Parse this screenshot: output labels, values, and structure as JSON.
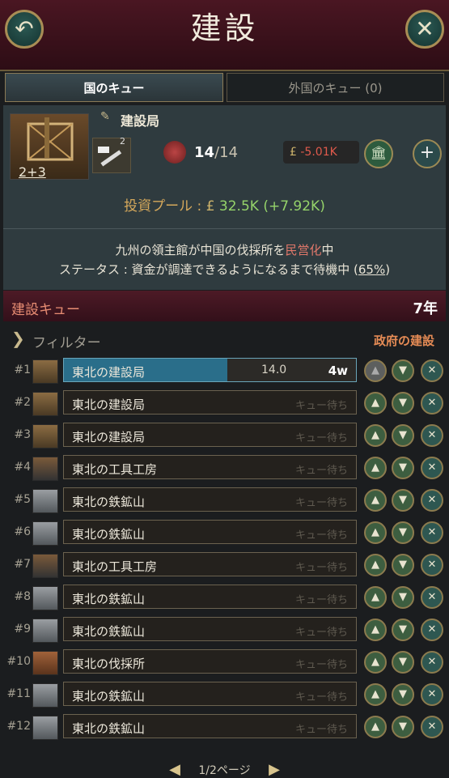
{
  "header": {
    "title": "建設",
    "back_icon": "↶",
    "close_icon": "✕"
  },
  "tabs": {
    "domestic": "国のキュー",
    "foreign": "外国のキュー (0)"
  },
  "building": {
    "name": "建設局",
    "level": "2+3",
    "hammer_count": "2",
    "wood_used": "14",
    "wood_max": "/14",
    "money_sign": "£",
    "money": "-5.01K",
    "add_icon": "+"
  },
  "pool": {
    "label": "投資プール : ",
    "currency": "£",
    "value": "32.5K",
    "delta": " (+7.92K)"
  },
  "status": {
    "l1a": "九州",
    "l1b": "の領主館が",
    "l1c": "中国",
    "l1d": "の伐採所を",
    "l1e": "民営化",
    "l1f": "中",
    "l2a": "ステータス : 資金が調達できるようになるまで待機中 (",
    "l2b": "65%",
    "l2c": ")"
  },
  "queue": {
    "title": "建設キュー",
    "years": "7年"
  },
  "filter": {
    "label": "フィルター",
    "gov": "政府の建設"
  },
  "rows": [
    {
      "num": "#1",
      "name": "東北の建設局",
      "status": "",
      "progress": "14.0",
      "weeks": "4w",
      "icon": "construction"
    },
    {
      "num": "#2",
      "name": "東北の建設局",
      "status": "キュー待ち",
      "icon": "construction"
    },
    {
      "num": "#3",
      "name": "東北の建設局",
      "status": "キュー待ち",
      "icon": "construction"
    },
    {
      "num": "#4",
      "name": "東北の工具工房",
      "status": "キュー待ち",
      "icon": "tools"
    },
    {
      "num": "#5",
      "name": "東北の鉄鉱山",
      "status": "キュー待ち",
      "icon": "iron"
    },
    {
      "num": "#6",
      "name": "東北の鉄鉱山",
      "status": "キュー待ち",
      "icon": "iron"
    },
    {
      "num": "#7",
      "name": "東北の工具工房",
      "status": "キュー待ち",
      "icon": "tools"
    },
    {
      "num": "#8",
      "name": "東北の鉄鉱山",
      "status": "キュー待ち",
      "icon": "iron"
    },
    {
      "num": "#9",
      "name": "東北の鉄鉱山",
      "status": "キュー待ち",
      "icon": "iron"
    },
    {
      "num": "#10",
      "name": "東北の伐採所",
      "status": "キュー待ち",
      "icon": "logging"
    },
    {
      "num": "#11",
      "name": "東北の鉄鉱山",
      "status": "キュー待ち",
      "icon": "iron"
    },
    {
      "num": "#12",
      "name": "東北の鉄鉱山",
      "status": "キュー待ち",
      "icon": "iron"
    }
  ],
  "row_buttons": {
    "up": "▲",
    "down": "▼",
    "remove": "✕"
  },
  "pager": {
    "prev": "◀",
    "label": "1/2ページ",
    "next": "▶"
  }
}
